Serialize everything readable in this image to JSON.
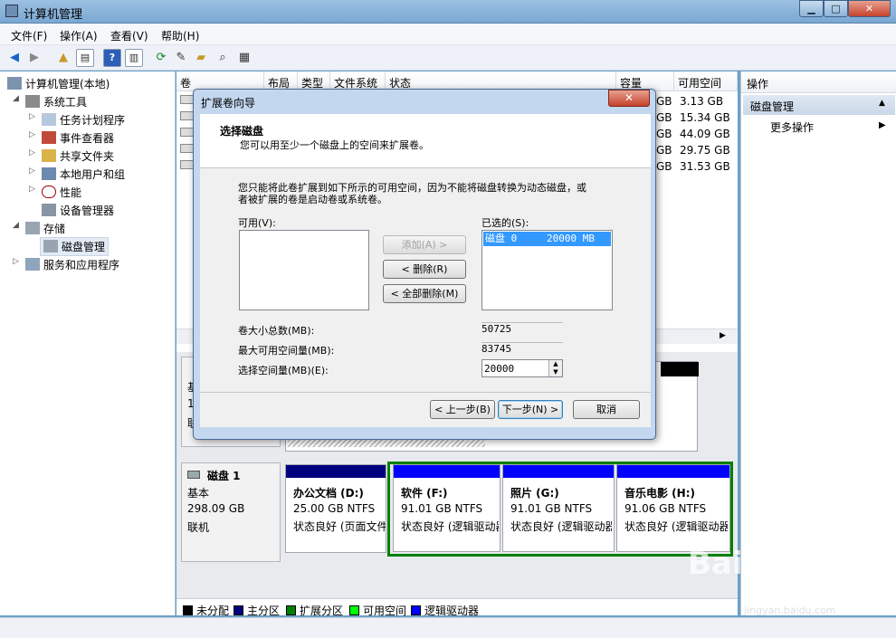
{
  "window": {
    "title": "计算机管理",
    "minimize": "▁",
    "maximize": "□",
    "close": "✕"
  },
  "menu": [
    "文件(F)",
    "操作(A)",
    "查看(V)",
    "帮助(H)"
  ],
  "toolbar": {
    "back": "back-arrow-icon",
    "forward": "forward-arrow-icon",
    "help": "?"
  },
  "tree": {
    "root": "计算机管理(本地)",
    "system_tools": "系统工具",
    "task_scheduler": "任务计划程序",
    "event_viewer": "事件查看器",
    "shared_folders": "共享文件夹",
    "local_users": "本地用户和组",
    "performance": "性能",
    "device_manager": "设备管理器",
    "storage": "存储",
    "disk_management": "磁盘管理",
    "services_apps": "服务和应用程序"
  },
  "volume_list": {
    "columns": [
      "卷",
      "布局",
      "类型",
      "文件系统",
      "状态",
      "容量",
      "可用空间"
    ],
    "capacity_suffix": [
      "GB",
      "GB",
      "GB",
      "GB",
      "GB"
    ],
    "free_space": [
      "3.13 GB",
      "15.34 GB",
      "44.09 GB",
      "29.75 GB",
      "31.53 GB"
    ]
  },
  "disk0": {
    "label_partial": [
      "基",
      "1",
      "联"
    ]
  },
  "disk1": {
    "name": "磁盘 1",
    "type": "基本",
    "size": "298.09 GB",
    "status": "联机",
    "partitions": [
      {
        "name": "办公文档 (D:)",
        "size": "25.00 GB NTFS",
        "status": "状态良好 (页面文件"
      },
      {
        "name": "软件 (F:)",
        "size": "91.01 GB NTFS",
        "status": "状态良好 (逻辑驱动器"
      },
      {
        "name": "照片 (G:)",
        "size": "91.01 GB NTFS",
        "status": "状态良好 (逻辑驱动器"
      },
      {
        "name": "音乐电影 (H:)",
        "size": "91.06 GB NTFS",
        "status": "状态良好 (逻辑驱动器"
      }
    ]
  },
  "legend": [
    "未分配",
    "主分区",
    "扩展分区",
    "可用空间",
    "逻辑驱动器"
  ],
  "colors": {
    "unallocated": "#000000",
    "primary": "#00007f",
    "extended": "#008000",
    "free": "#00ff00",
    "logical": "#0000ff"
  },
  "actions": {
    "header": "操作",
    "section": "磁盘管理",
    "more": "更多操作"
  },
  "dialog": {
    "title": "扩展卷向导",
    "close": "✕",
    "heading": "选择磁盘",
    "subheading": "您可以用至少一个磁盘上的空间来扩展卷。",
    "description_line1": "您只能将此卷扩展到如下所示的可用空间，因为不能将磁盘转换为动态磁盘，或",
    "description_line2": "者被扩展的卷是启动卷或系统卷。",
    "available_label": "可用(V):",
    "selected_label": "已选的(S):",
    "add_button": "添加(A) >",
    "remove_button": "< 删除(R)",
    "remove_all_button": "< 全部删除(M)",
    "selected_item_disk": "磁盘 0",
    "selected_item_size": "20000 MB",
    "total_size_label": "卷大小总数(MB):",
    "total_size_value": "50725",
    "max_space_label": "最大可用空间量(MB):",
    "max_space_value": "83745",
    "select_space_label": "选择空间量(MB)(E):",
    "select_space_value": "20000",
    "back_button": "< 上一步(B)",
    "next_button": "下一步(N) >",
    "cancel_button": "取消"
  },
  "watermark": {
    "logo": "Baidu经验",
    "url": "jingyan.baidu.com"
  }
}
